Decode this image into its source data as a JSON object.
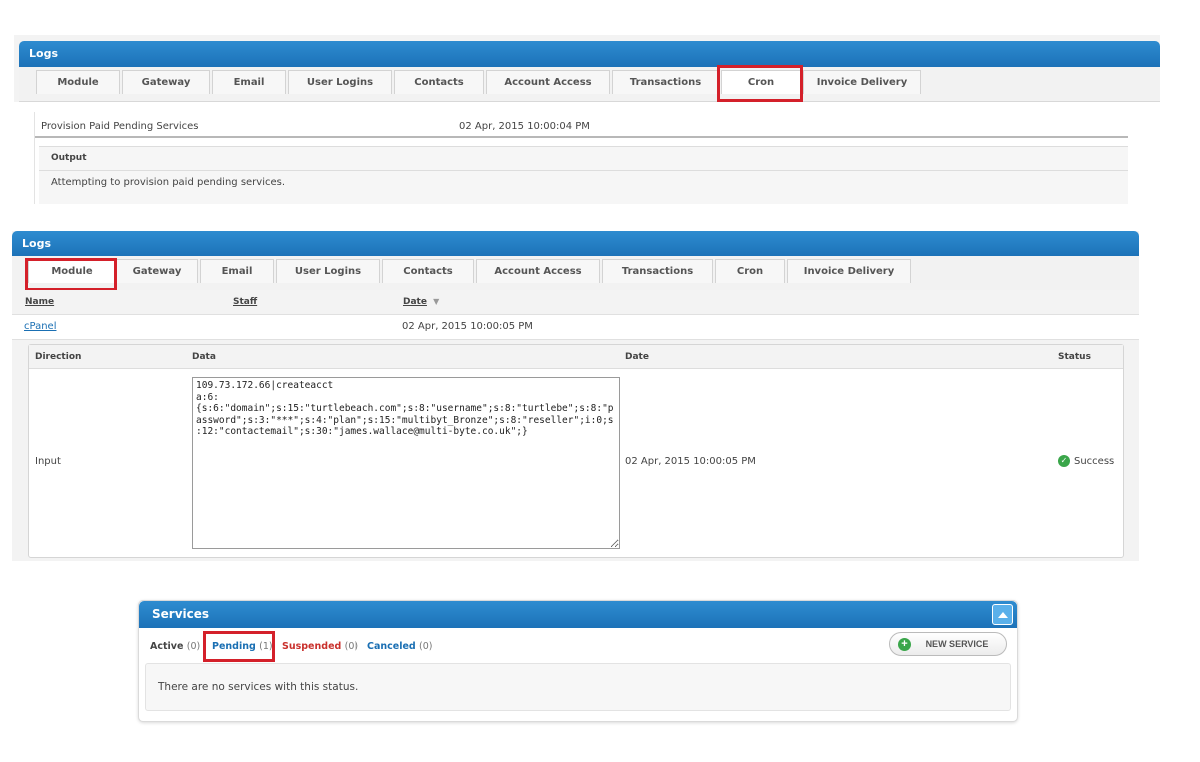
{
  "cron_panel": {
    "title": "Logs",
    "tabs": [
      "Module",
      "Gateway",
      "Email",
      "User Logins",
      "Contacts",
      "Account Access",
      "Transactions",
      "Cron",
      "Invoice Delivery"
    ],
    "highlighted_tab": "Cron",
    "entry": {
      "task": "Provision Paid Pending Services",
      "date": "02 Apr, 2015 10:00:04 PM"
    },
    "output": {
      "label": "Output",
      "text": "Attempting to provision paid pending services."
    }
  },
  "module_panel": {
    "title": "Logs",
    "tabs": [
      "Module",
      "Gateway",
      "Email",
      "User Logins",
      "Contacts",
      "Account Access",
      "Transactions",
      "Cron",
      "Invoice Delivery"
    ],
    "highlighted_tab": "Module",
    "columns": {
      "name": "Name",
      "staff": "Staff",
      "date": "Date"
    },
    "sort_icon": "sort-desc-icon",
    "row": {
      "name": "cPanel",
      "staff": "",
      "date": "02 Apr, 2015 10:00:05 PM"
    },
    "detail": {
      "headers": {
        "direction": "Direction",
        "data": "Data",
        "date": "Date",
        "status": "Status"
      },
      "direction": "Input",
      "data": "109.73.172.66|createacct\na:6:\n{s:6:\"domain\";s:15:\"turtlebeach.com\";s:8:\"username\";s:8:\"turtlebe\";s:8:\"password\";s:3:\"***\";s:4:\"plan\";s:15:\"multibyt_Bronze\";s:8:\"reseller\";i:0;s:12:\"contactemail\";s:30:\"james.wallace@multi-byte.co.uk\";}",
      "date": "02 Apr, 2015 10:00:05 PM",
      "status": "Success",
      "status_icon": "check-circle-icon"
    }
  },
  "services_panel": {
    "title": "Services",
    "filters": [
      {
        "label": "Active",
        "count": "(0)"
      },
      {
        "label": "Pending",
        "count": "(1)"
      },
      {
        "label": "Suspended",
        "count": "(0)"
      },
      {
        "label": "Canceled",
        "count": "(0)"
      }
    ],
    "separator": "|",
    "new_service_label": "NEW SERVICE",
    "empty_message": "There are no services with this status."
  },
  "colors": {
    "header_blue": "#1c72b8",
    "highlight_red": "#d4202a",
    "link_blue": "#1a6fb3",
    "suspended_red": "#c9302c",
    "success_green": "#3aa64a"
  }
}
